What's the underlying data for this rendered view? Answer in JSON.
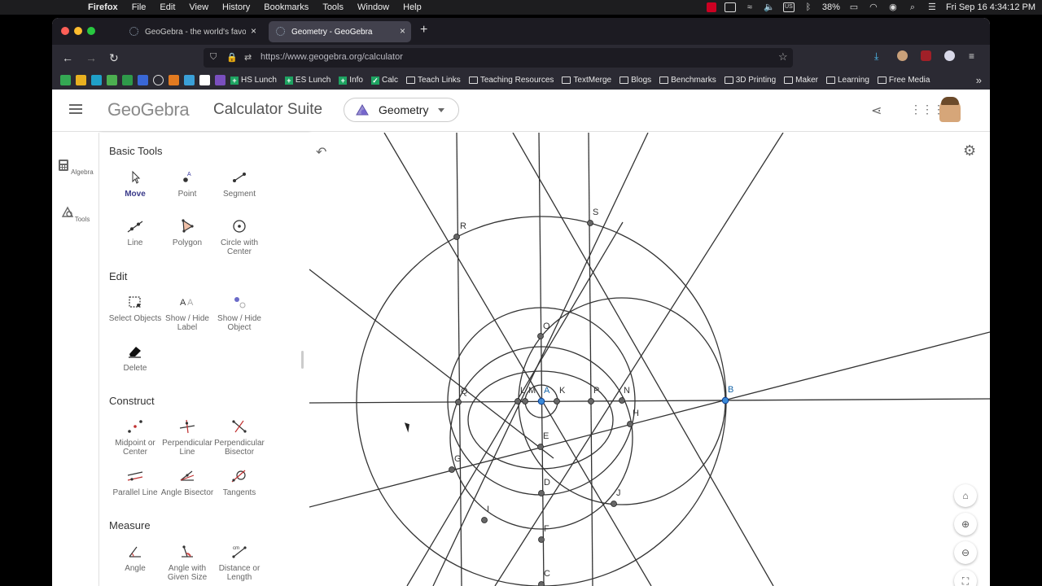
{
  "menubar": {
    "app": "Firefox",
    "items": [
      "File",
      "Edit",
      "View",
      "History",
      "Bookmarks",
      "Tools",
      "Window",
      "Help"
    ],
    "battery": "38%",
    "datetime": "Fri Sep 16  4:34:12 PM"
  },
  "browser": {
    "tabs": [
      {
        "title": "GeoGebra - the world's favorite, fr"
      },
      {
        "title": "Geometry - GeoGebra"
      }
    ],
    "url": "https://www.geogebra.org/calculator",
    "bookmarks": [
      "HS Lunch",
      "ES Lunch",
      "Info",
      "Calc",
      "Teach Links",
      "Teaching Resources",
      "TextMerge",
      "Blogs",
      "Benchmarks",
      "3D Printing",
      "Maker",
      "Learning",
      "Free Media"
    ]
  },
  "header": {
    "logo": "GeoGebra",
    "suite": "Calculator Suite",
    "app": "Geometry"
  },
  "strip": {
    "algebra": "Algebra",
    "tools": "Tools"
  },
  "tools": {
    "basic_title": "Basic Tools",
    "basic": [
      "Move",
      "Point",
      "Segment",
      "Line",
      "Polygon",
      "Circle with Center"
    ],
    "edit_title": "Edit",
    "edit": [
      "Select Objects",
      "Show / Hide Label",
      "Show / Hide Object",
      "Delete"
    ],
    "construct_title": "Construct",
    "construct": [
      "Midpoint or Center",
      "Perpendicular Line",
      "Perpendicular Bisector",
      "Parallel Line",
      "Angle Bisector",
      "Tangents"
    ],
    "measure_title": "Measure",
    "measure": [
      "Angle",
      "Angle with Given Size",
      "Distance or Length"
    ]
  },
  "graphics": {
    "points": [
      "R",
      "S",
      "O",
      "Q",
      "L",
      "M",
      "A",
      "K",
      "P",
      "N",
      "B",
      "H",
      "E",
      "G",
      "D",
      "J",
      "I",
      "F",
      "C"
    ]
  }
}
